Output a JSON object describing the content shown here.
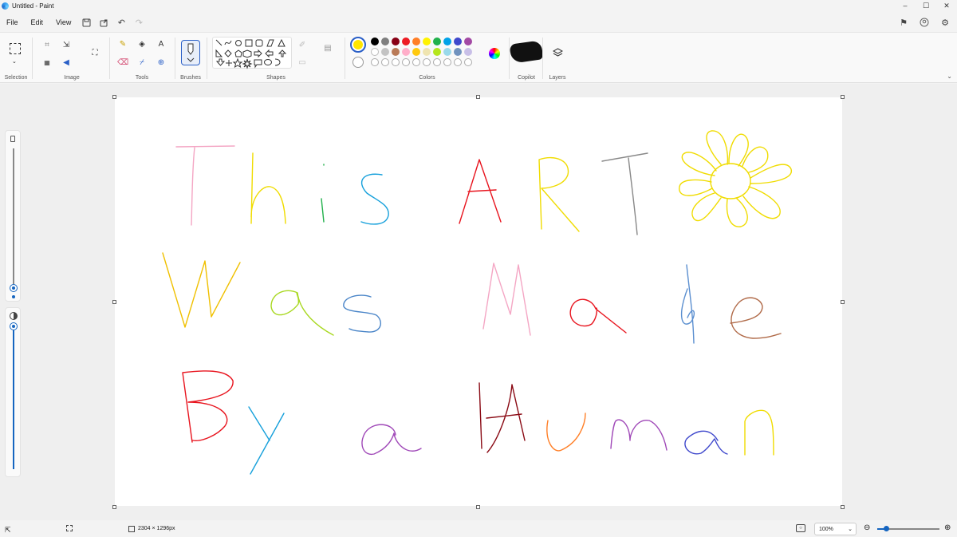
{
  "window": {
    "title": "Untitled - Paint",
    "controls": [
      "–",
      "☐",
      "✕"
    ]
  },
  "menu": {
    "file": "File",
    "edit": "Edit",
    "view": "View"
  },
  "ribbon": {
    "selection_label": "Selection",
    "image_label": "Image",
    "tools_label": "Tools",
    "text_tool": "A",
    "brushes_label": "Brushes",
    "shapes_label": "Shapes",
    "colors_label": "Colors",
    "copilot_label": "Copilot",
    "layers_label": "Layers"
  },
  "colors": {
    "primary": "#ffe600",
    "row1": [
      "#000000",
      "#7f7f7f",
      "#880015",
      "#ed1c24",
      "#ff7f27",
      "#fff200",
      "#22b14c",
      "#00a2e8",
      "#3f48cc",
      "#a349a4"
    ],
    "row2": [
      "#ffffff",
      "#c3c3c3",
      "#b97a57",
      "#ffaec9",
      "#ffc90e",
      "#efe4b0",
      "#b5e61d",
      "#99d9ea",
      "#7092be",
      "#c8bfe7"
    ]
  },
  "status": {
    "canvas_size": "2304 × 1296px",
    "zoom": "100%"
  }
}
